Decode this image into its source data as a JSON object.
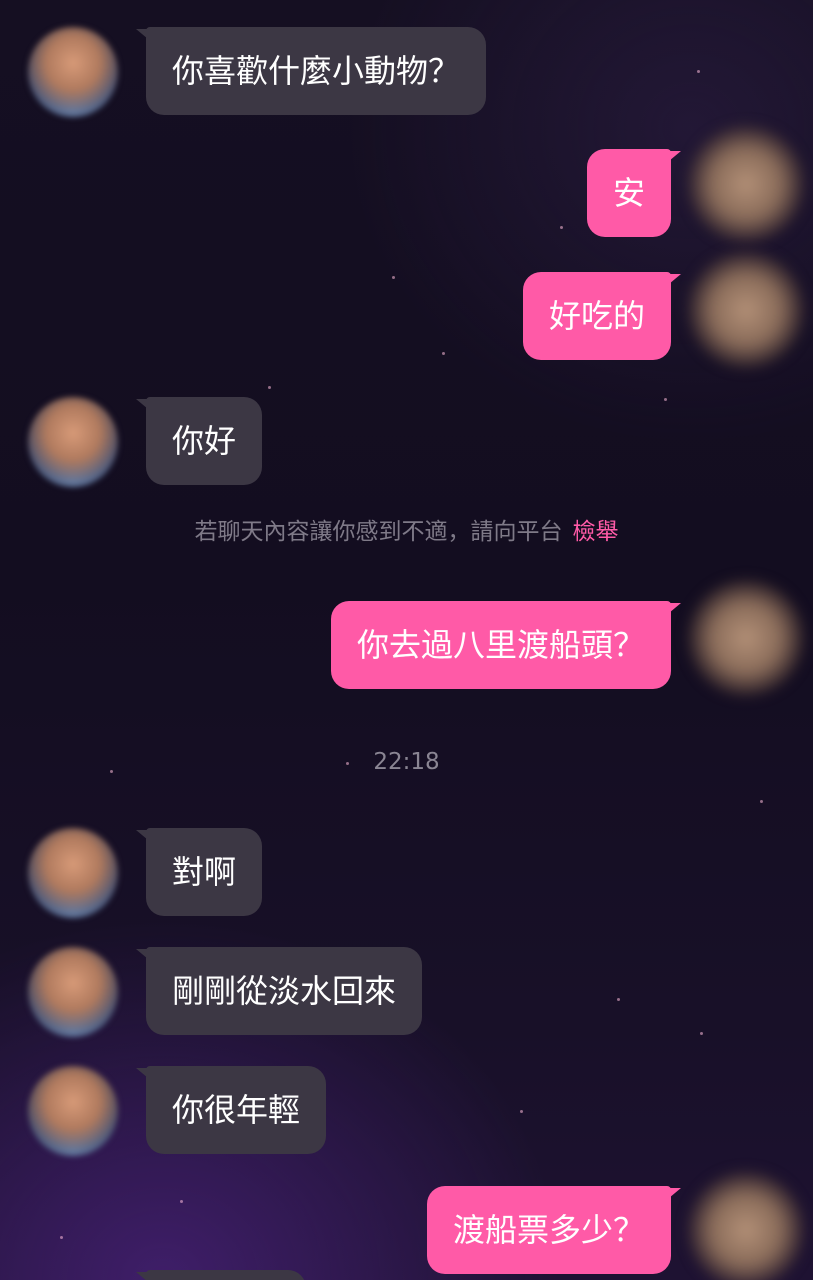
{
  "messages": [
    {
      "from": "them",
      "text": "你喜歡什麼小動物？"
    },
    {
      "from": "me",
      "text": "安"
    },
    {
      "from": "me",
      "text": "好吃的"
    },
    {
      "from": "them",
      "text": "你好"
    },
    {
      "from": "me",
      "text": "你去過八里渡船頭？"
    },
    {
      "from": "them",
      "text": "對啊"
    },
    {
      "from": "them",
      "text": "剛剛從淡水回來"
    },
    {
      "from": "them",
      "text": "你很年輕"
    },
    {
      "from": "me",
      "text": "渡船票多少？"
    }
  ],
  "notice": {
    "text": "若聊天內容讓你感到不適，請向平台",
    "report_link": "檢舉"
  },
  "timestamp": "22:18",
  "colors": {
    "my_bubble": "#ff5aa7",
    "their_bubble": "#3c3744",
    "link": "#ff5aa7"
  }
}
